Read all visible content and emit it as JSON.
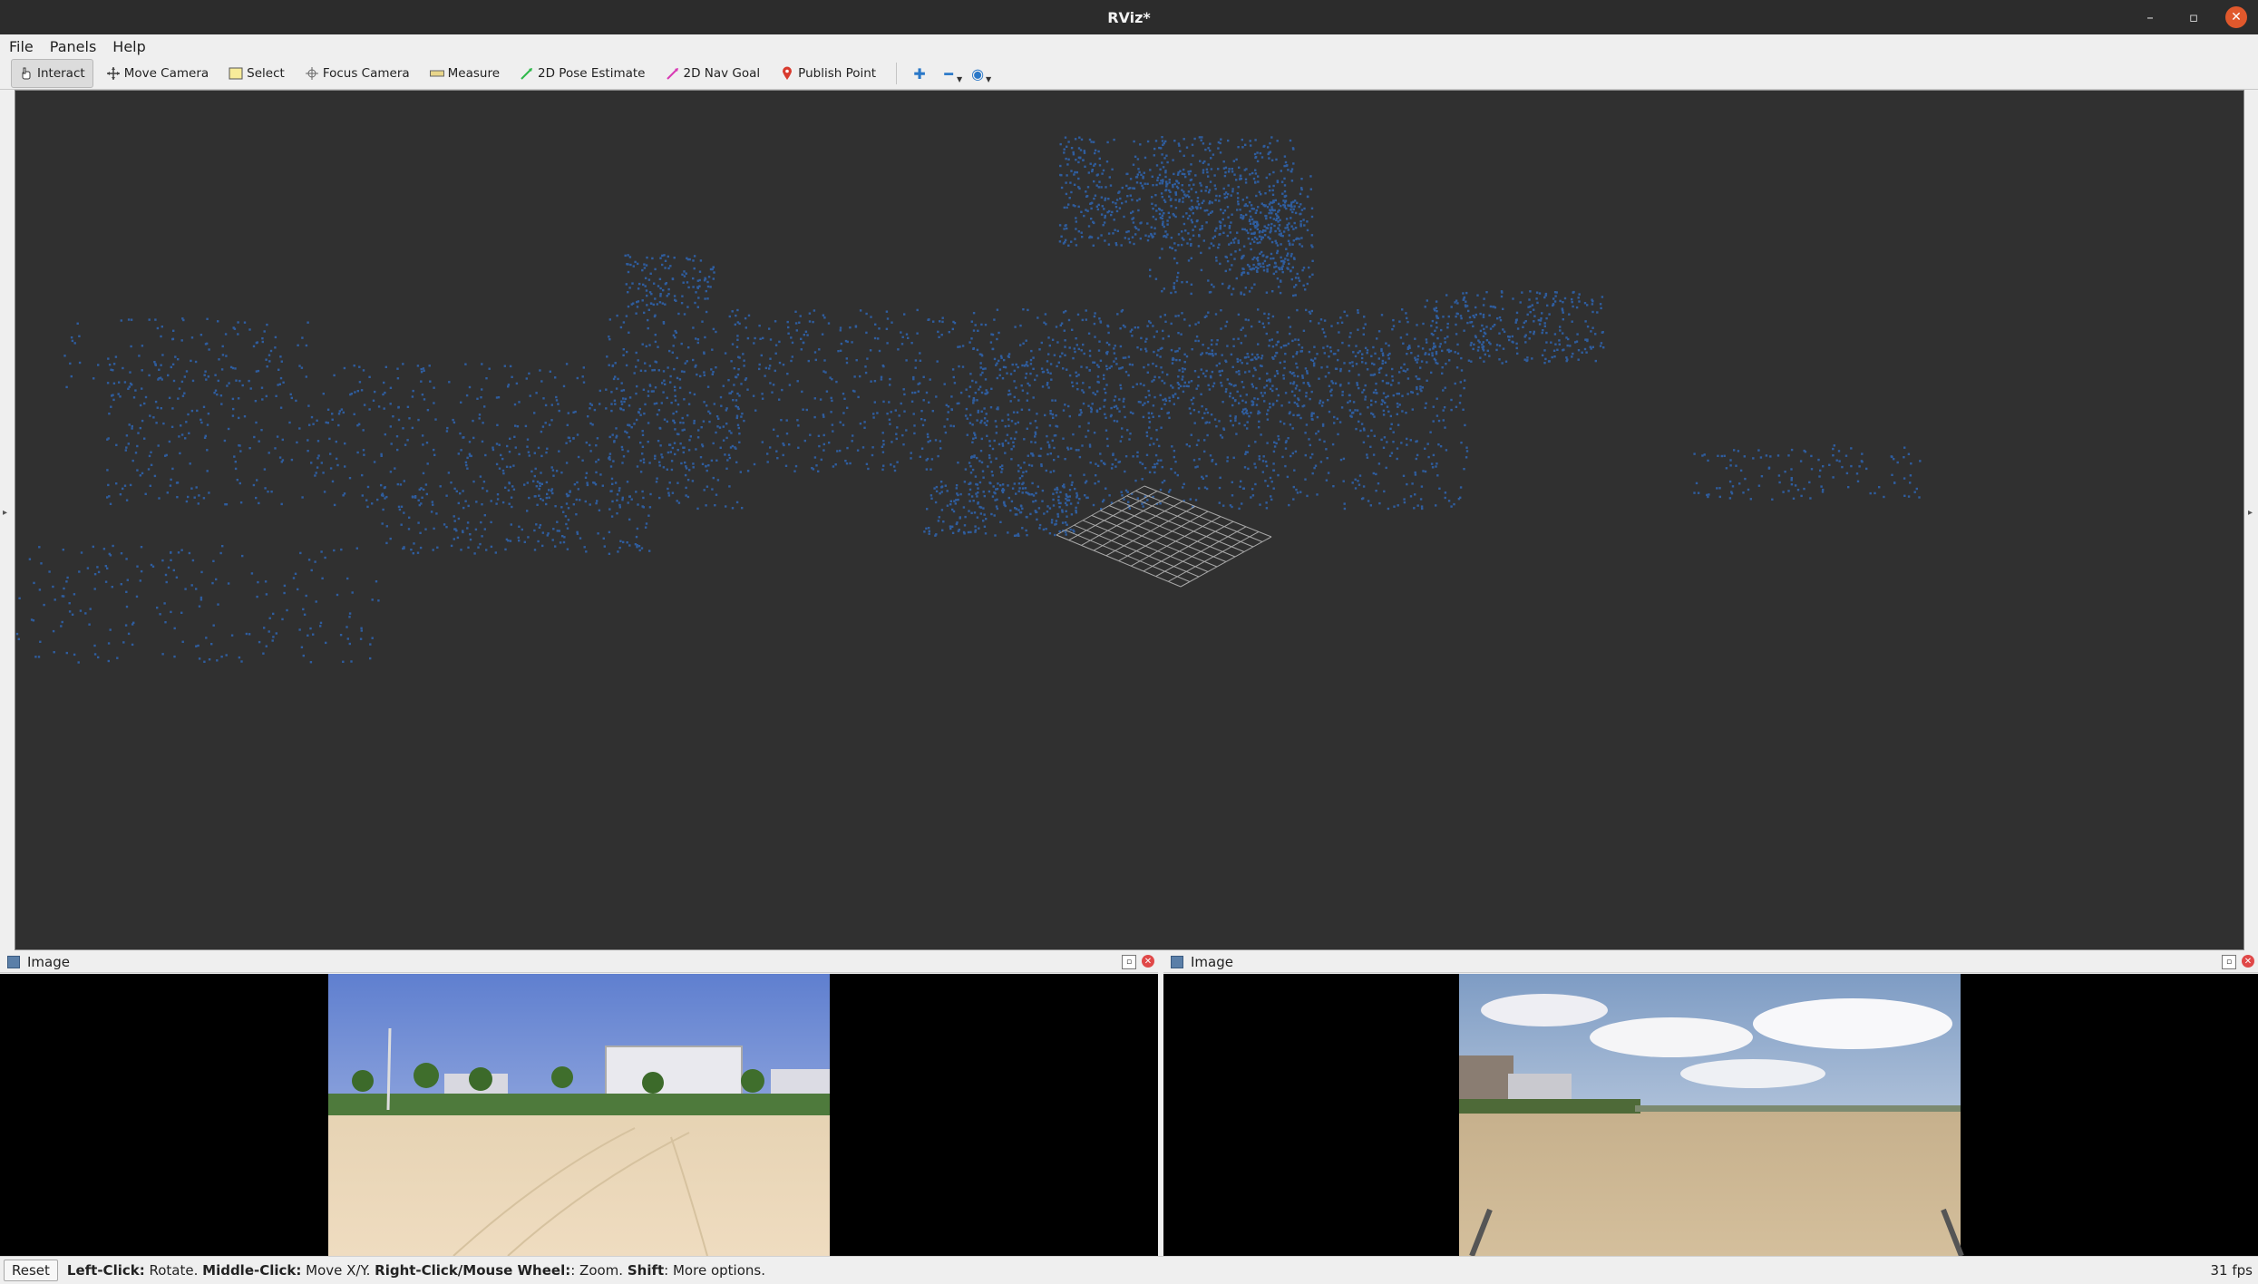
{
  "window": {
    "title": "RViz*",
    "controls": [
      "–",
      "▫",
      "✕"
    ]
  },
  "menu": [
    {
      "label": "File"
    },
    {
      "label": "Panels"
    },
    {
      "label": "Help"
    }
  ],
  "toolbar": {
    "interact": "Interact",
    "move_camera": "Move Camera",
    "select": "Select",
    "focus_camera": "Focus Camera",
    "measure": "Measure",
    "pose_estimate": "2D Pose Estimate",
    "nav_goal": "2D Nav Goal",
    "publish_point": "Publish Point"
  },
  "panels": [
    {
      "title": "Image"
    },
    {
      "title": "Image"
    }
  ],
  "status": {
    "reset": "Reset",
    "hint_left_click": "Left-Click:",
    "hint_rotate": " Rotate. ",
    "hint_middle_click": "Middle-Click:",
    "hint_move": " Move X/Y. ",
    "hint_right_click": "Right-Click/Mouse Wheel:",
    "hint_zoom": ": Zoom. ",
    "hint_shift": "Shift",
    "hint_more": ": More options.",
    "fps": "31 fps"
  },
  "colors": {
    "point_cloud": "#2f5d9e",
    "viewport_bg": "#303030",
    "grid": "#a8a8a8"
  }
}
